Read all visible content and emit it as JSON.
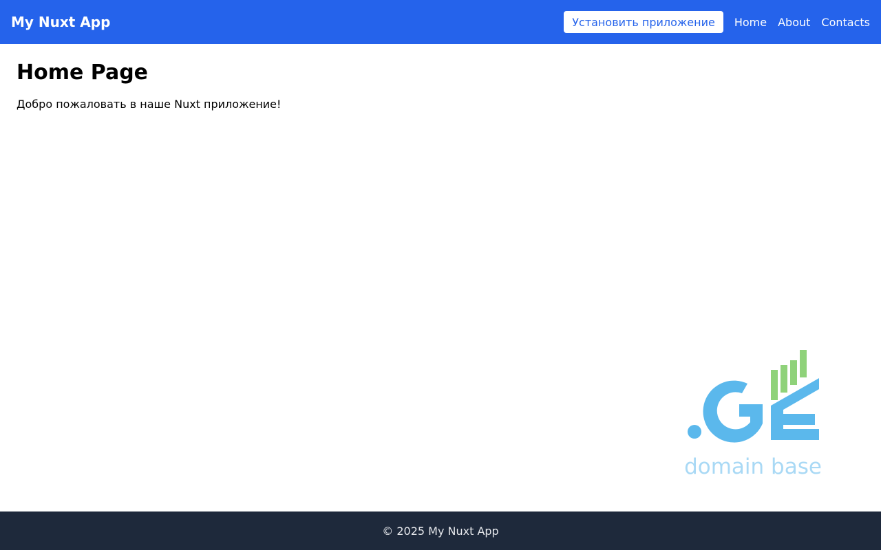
{
  "header": {
    "brand": "My Nuxt App",
    "install_label": "Установить приложение",
    "nav": [
      {
        "label": "Home"
      },
      {
        "label": "About"
      },
      {
        "label": "Contacts"
      }
    ]
  },
  "main": {
    "title": "Home Page",
    "welcome": "Добро пожаловать в наше Nuxt приложение!"
  },
  "logo": {
    "mark": ".GE",
    "caption": "domain base",
    "icon": "ge-domain-base-logo"
  },
  "footer": {
    "copyright": "© 2025 My Nuxt App"
  },
  "colors": {
    "header_bg": "#2563eb",
    "footer_bg": "#1e293b",
    "logo_blue": "#5bb8ec",
    "logo_green": "#8fd27a",
    "logo_caption": "#a9d9f5"
  }
}
